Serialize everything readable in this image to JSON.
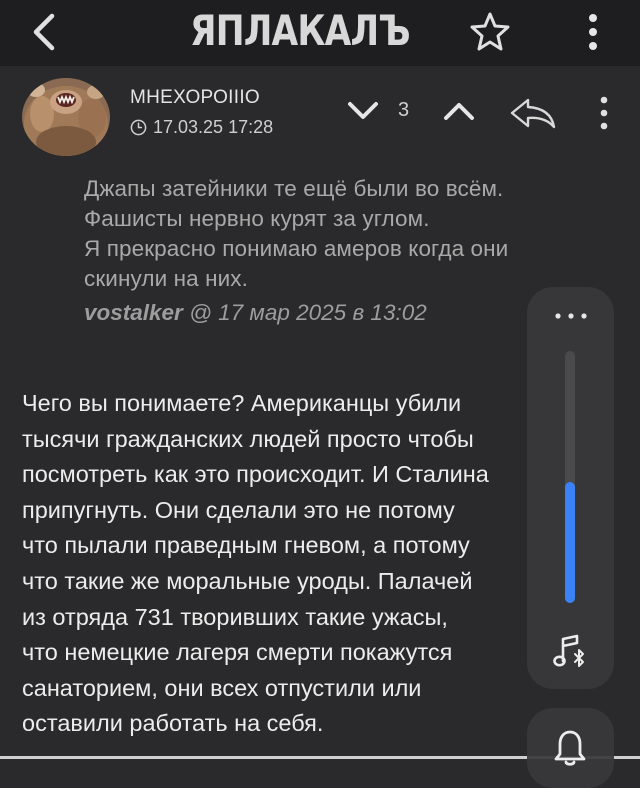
{
  "header": {
    "logo_text": "ЯПЛАКАЛЪ",
    "icons": [
      "back-arrow",
      "star-outline",
      "more-vertical"
    ]
  },
  "post": {
    "username": "МНЕХОРОIIIО",
    "datetime": "17.03.25 17:28",
    "votes": "3",
    "icons": [
      "clock",
      "chevron-down",
      "chevron-up",
      "reply-arrow",
      "more-vertical"
    ]
  },
  "quote": {
    "lines": [
      "Джапы затейники те ещё были во всём.",
      "Фашисты нервно курят за углом.",
      "Я прекрасно понимаю амеров когда они",
      "скинули на них."
    ],
    "author": "vostalker",
    "meta": " @ 17 мар 2025 в 13:02"
  },
  "body": {
    "lines": [
      "Чего вы понимаете? Американцы убили",
      "тысячи гражданских людей просто чтобы",
      "посмотреть как это происходит. И Сталина",
      "припугнуть. Они сделали это не потому",
      "что пылали праведным гневом, а потому",
      "что такие же моральные уроды. Палачей",
      "из отряда 731 творивших такие ужасы,",
      "что немецкие лагеря смерти покажутся",
      "санаторием, они всех отпустили или",
      "оставили работать на себя."
    ]
  },
  "volume_overlay": {
    "level": 0.48,
    "accent_color": "#3b82f6",
    "icons": [
      "more-horizontal",
      "bluetooth-audio",
      "bell"
    ]
  }
}
